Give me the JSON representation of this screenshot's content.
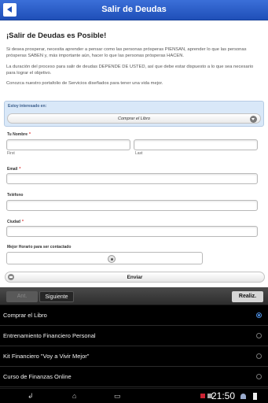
{
  "header": {
    "title": "Salir de Deudas"
  },
  "intro": {
    "heading": "¡Salir de Deudas es Posible!",
    "paragraphs": [
      "Si desea prosperar, necesita aprender a pensar como las personas prósperas PIENSAN, aprender lo que las personas prósperas SABEN y, más importante aún, hacer lo que las personas prósperas HACEN.",
      "La duración del proceso para salir de deudas DEPENDE DE USTED, así que debe estar dispuesto a lo que sea necesario para lograr el objetivo.",
      "Conozca nuestro portafolio de Servicios diseñados para tener una vida mejor."
    ]
  },
  "form": {
    "interest_label": "Estoy interesado en:",
    "interest_value": "Comprar el Libro",
    "name_label": "Tu Nombre",
    "first_label": "First",
    "last_label": "Last",
    "email_label": "Email",
    "phone_label": "Teléfono",
    "city_label": "Ciudad",
    "schedule_label": "Mejor Horario para ser contactado",
    "required_mark": "*",
    "submit_label": "Enviar"
  },
  "accessory": {
    "prev_label": "Ant.",
    "next_label": "Siguiente",
    "done_label": "Realiz."
  },
  "picker": {
    "options": [
      {
        "label": "Comprar el Libro",
        "selected": true
      },
      {
        "label": "Entrenamiento Financiero Personal",
        "selected": false
      },
      {
        "label": "Kit Financiero \"Voy a Vivir Mejor\"",
        "selected": false
      },
      {
        "label": "Curso de Finanzas Online",
        "selected": false
      }
    ]
  },
  "status": {
    "time": "21:50",
    "nav_icons": [
      "back-icon",
      "home-icon",
      "recent-apps-icon"
    ],
    "status_icons": [
      "notification-icon",
      "wifi-icon",
      "battery-icon"
    ]
  },
  "colors": {
    "header_blue": "#2a5cc8",
    "panel_blue": "#d9e8f8",
    "required": "#d22222",
    "radio_active": "#4d8fe3"
  }
}
